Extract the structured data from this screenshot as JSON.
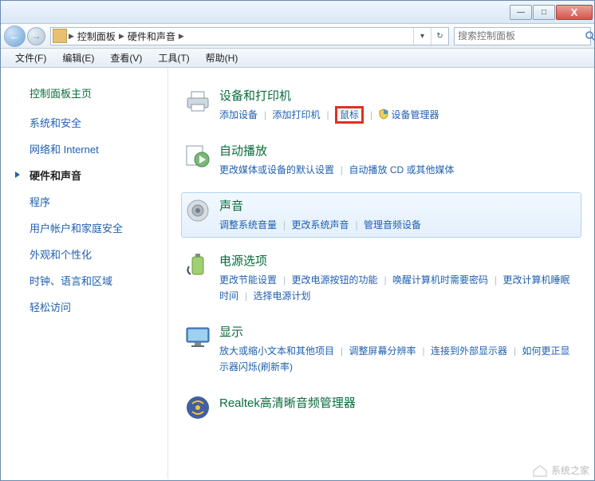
{
  "titlebar": {
    "minimize": "—",
    "maximize": "□",
    "close": "X"
  },
  "nav": {
    "back": "←",
    "forward": "→",
    "sep": "▶",
    "dropdown": "▾",
    "refresh": "↻"
  },
  "breadcrumb": {
    "level1": "控制面板",
    "level2": "硬件和声音"
  },
  "search": {
    "placeholder": "搜索控制面板"
  },
  "menu": {
    "file": "文件(F)",
    "edit": "编辑(E)",
    "view": "查看(V)",
    "tools": "工具(T)",
    "help": "帮助(H)"
  },
  "sidebar": {
    "home": "控制面板主页",
    "items": [
      "系统和安全",
      "网络和 Internet",
      "硬件和声音",
      "程序",
      "用户帐户和家庭安全",
      "外观和个性化",
      "时钟、语言和区域",
      "轻松访问"
    ],
    "current_index": 2
  },
  "content": {
    "devices": {
      "title": "设备和打印机",
      "links": [
        "添加设备",
        "添加打印机",
        "鼠标",
        "设备管理器"
      ]
    },
    "autoplay": {
      "title": "自动播放",
      "links": [
        "更改媒体或设备的默认设置",
        "自动播放 CD 或其他媒体"
      ]
    },
    "sound": {
      "title": "声音",
      "links": [
        "调整系统音量",
        "更改系统声音",
        "管理音频设备"
      ]
    },
    "power": {
      "title": "电源选项",
      "links": [
        "更改节能设置",
        "更改电源按钮的功能",
        "唤醒计算机时需要密码",
        "更改计算机睡眠时间",
        "选择电源计划"
      ]
    },
    "display": {
      "title": "显示",
      "links": [
        "放大或缩小文本和其他项目",
        "调整屏幕分辨率",
        "连接到外部显示器",
        "如何更正显示器闪烁(刷新率)"
      ]
    },
    "realtek": {
      "title": "Realtek高清晰音频管理器"
    }
  },
  "watermark": "系统之家"
}
